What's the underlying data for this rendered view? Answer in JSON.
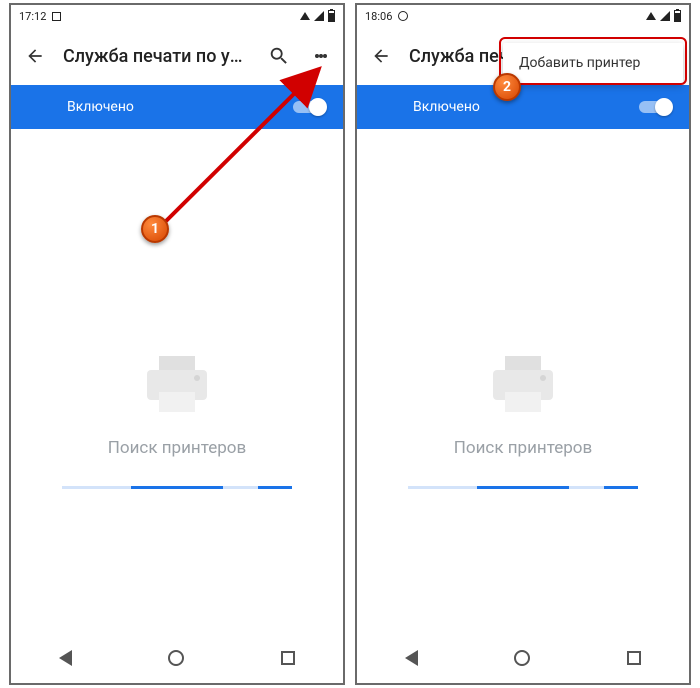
{
  "left": {
    "status_time": "17:12",
    "appbar_title": "Служба печати по умо...",
    "toggle_label": "Включено",
    "searching_text": "Поиск принтеров"
  },
  "right": {
    "status_time": "18:06",
    "appbar_title": "Служба печа",
    "toggle_label": "Включено",
    "searching_text": "Поиск принтеров",
    "menu_item": "Добавить принтер"
  },
  "callout": {
    "c1": "1",
    "c2": "2"
  }
}
